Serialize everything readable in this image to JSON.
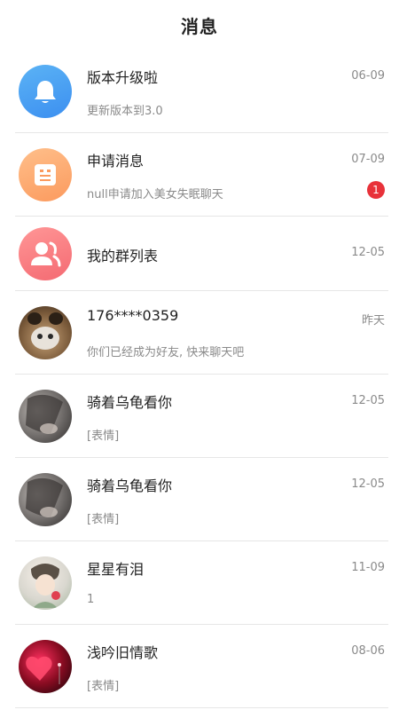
{
  "header": {
    "title": "消息"
  },
  "messages": [
    {
      "name": "版本升级啦",
      "sub": "更新版本到3.0",
      "time": "06-09",
      "avatar": "bell-icon"
    },
    {
      "name": "申请消息",
      "sub": "null申请加入美女失眠聊天",
      "time": "07-09",
      "badge": "1",
      "avatar": "document-icon"
    },
    {
      "name": "我的群列表",
      "time": "12-05",
      "avatar": "group-icon"
    },
    {
      "name": "176****0359",
      "sub": "你们已经成为好友, 快来聊天吧",
      "time": "昨天",
      "avatar": "cat-photo"
    },
    {
      "name": "骑着乌龟看你",
      "sub": "[表情]",
      "time": "12-05",
      "avatar": "girl-photo"
    },
    {
      "name": "骑着乌龟看你",
      "sub": "[表情]",
      "time": "12-05",
      "avatar": "girl-photo"
    },
    {
      "name": "星星有泪",
      "sub": "1",
      "time": "11-09",
      "avatar": "boy-illustration"
    },
    {
      "name": "浅吟旧情歌",
      "sub": "[表情]",
      "time": "08-06",
      "avatar": "heart-photo"
    }
  ]
}
